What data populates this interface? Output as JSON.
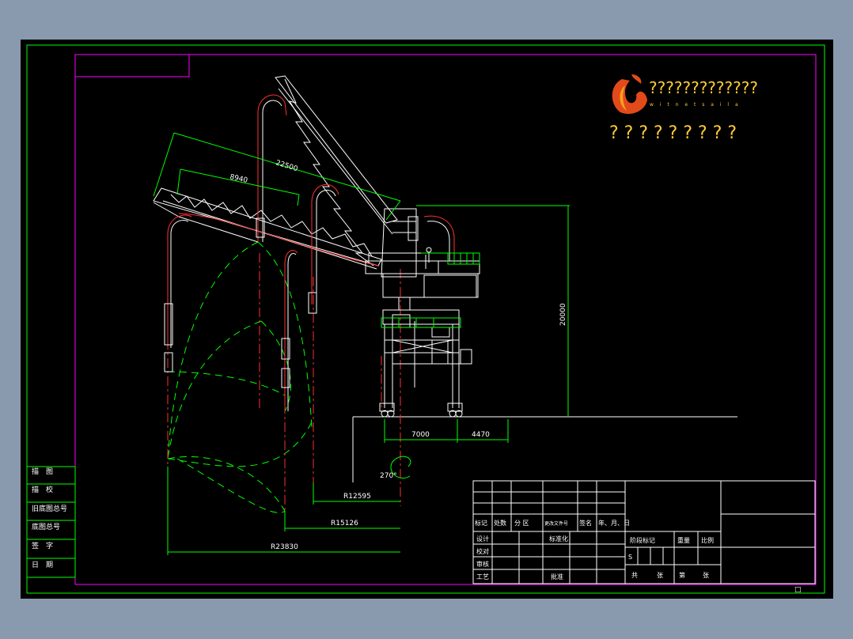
{
  "colors": {
    "background": "#8a9aae",
    "sheet": "#000000",
    "frame": "#00ff00",
    "inner_frame": "#ff00ff",
    "structure": "#ffffff",
    "hose": "#ff3030",
    "centerline": "#ff3030",
    "arcs": "#00ff00",
    "logo_text": "#ffcc33"
  },
  "logo": {
    "title": "?????????????",
    "subtitle": "? ? ? ? ? ? ? ? ?"
  },
  "dimensions": {
    "boom_length": "22500",
    "arm_length": "8940",
    "height": "20000",
    "rail_gauge": "7000",
    "offset": "4470",
    "slew_angle": "270°",
    "radius_1": "R12595",
    "radius_2": "R15126",
    "radius_3": "R23830"
  },
  "left_stamp": {
    "rows": [
      "描　图",
      "描　校",
      "旧底图总号",
      "底图总号",
      "签　字",
      "日　期"
    ]
  },
  "title_block": {
    "header_labels": [
      "标记",
      "处数",
      "分 区",
      "更改文件号",
      "签名",
      "年、月、日"
    ],
    "rows": [
      "设计",
      "校对",
      "审核",
      "工艺"
    ],
    "std_label": "标准化",
    "approve_label": "批准",
    "stage_label": "阶段标记",
    "weight_label": "重量",
    "scale_label": "比例",
    "stage_value": "S",
    "total_label": "共",
    "sheets_label": "张",
    "sheet_no_label": "第",
    "sheet_no_unit": "张",
    "corner_mark": "□"
  }
}
